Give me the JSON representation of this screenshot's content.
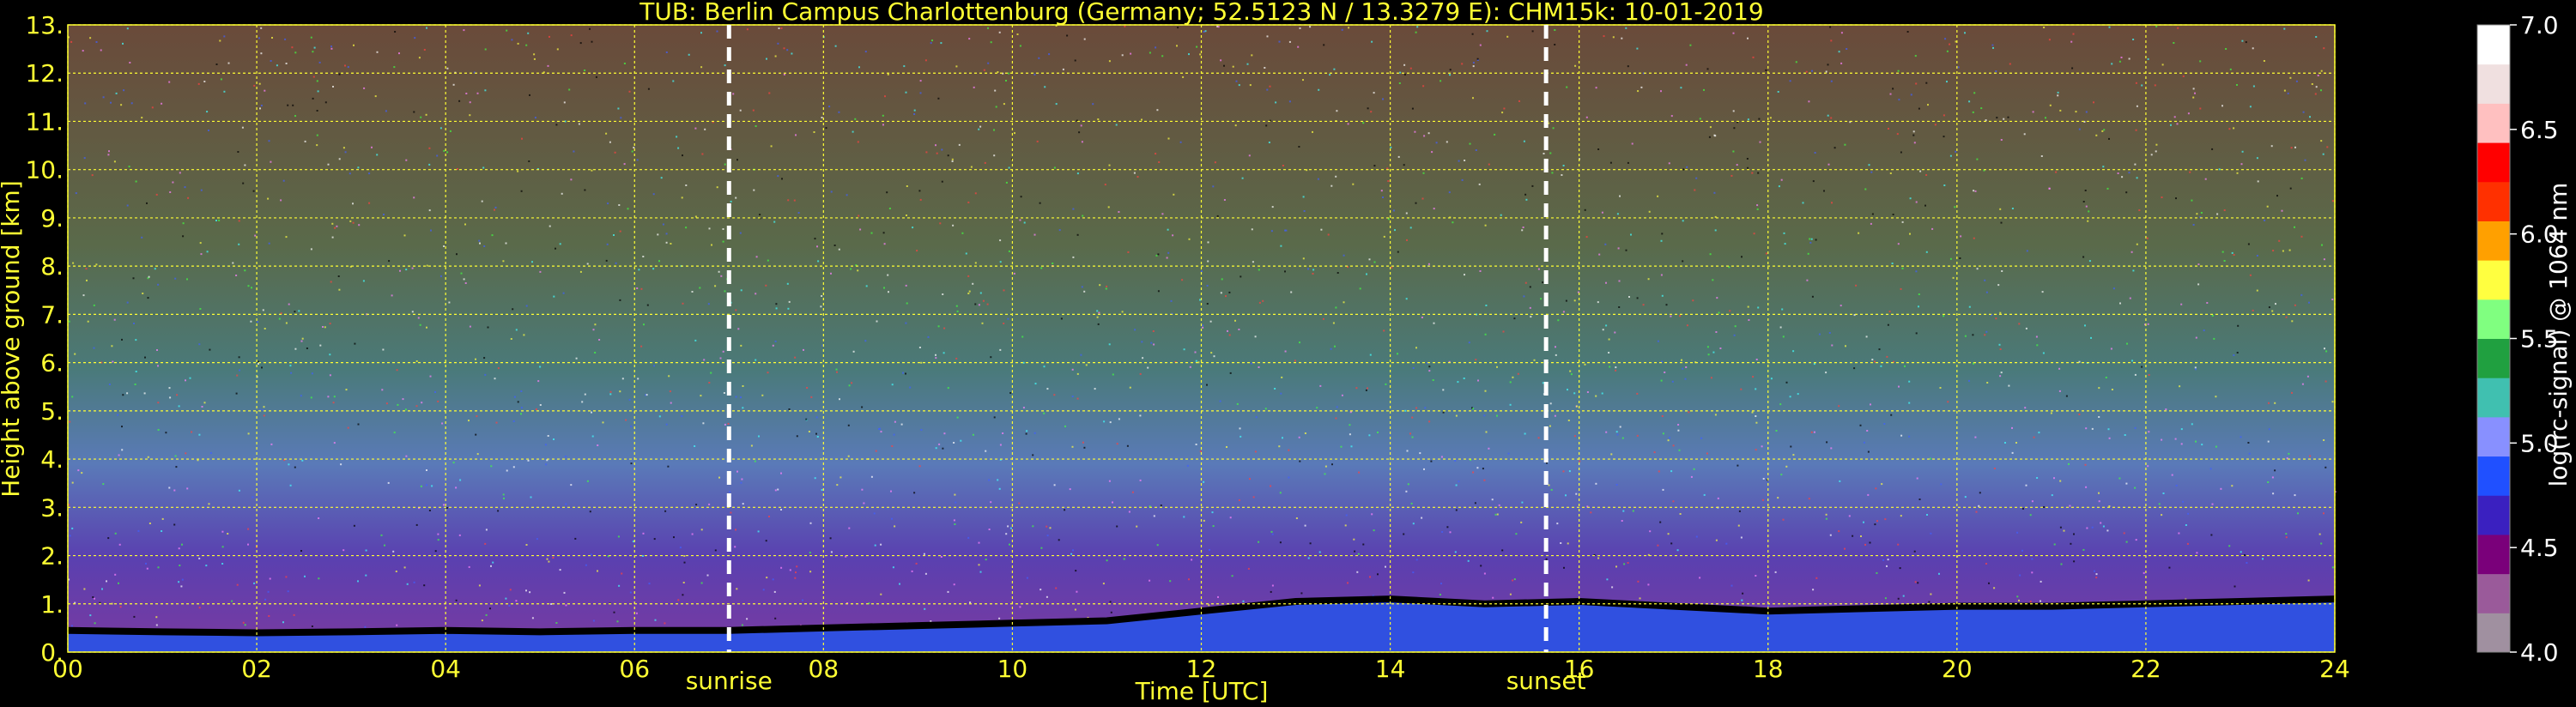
{
  "chart_data": {
    "type": "heatmap",
    "title": "TUB: Berlin Campus Charlottenburg (Germany; 52.5123 N / 13.3279 E):    CHM15k: 10-01-2019",
    "xlabel": "Time [UTC]",
    "ylabel": "Height above ground [km]",
    "xlim": [
      0,
      24
    ],
    "ylim": [
      0,
      13
    ],
    "x_ticks": [
      "00",
      "02",
      "04",
      "06",
      "08",
      "10",
      "12",
      "14",
      "16",
      "18",
      "20",
      "22",
      "24"
    ],
    "y_ticks": [
      "0.",
      "1.",
      "2.",
      "3.",
      "4.",
      "5.",
      "6.",
      "7.",
      "8.",
      "9.",
      "10.",
      "11.",
      "12.",
      "13."
    ],
    "grid": true,
    "colorbar": {
      "label": "log(rc-signal) @ 1064 nm",
      "range": [
        4.0,
        7.0
      ],
      "ticks": [
        "4.0",
        "4.5",
        "5.0",
        "5.5",
        "6.0",
        "6.5",
        "7.0"
      ]
    },
    "annotations": [
      {
        "label": "sunrise",
        "time": 7.0
      },
      {
        "label": "sunset",
        "time": 15.65
      }
    ],
    "boundary_layer_top_km": [
      {
        "t": 0,
        "h": 0.45
      },
      {
        "t": 1,
        "h": 0.42
      },
      {
        "t": 2,
        "h": 0.4
      },
      {
        "t": 3,
        "h": 0.42
      },
      {
        "t": 4,
        "h": 0.45
      },
      {
        "t": 5,
        "h": 0.42
      },
      {
        "t": 6,
        "h": 0.45
      },
      {
        "t": 7,
        "h": 0.45
      },
      {
        "t": 8,
        "h": 0.5
      },
      {
        "t": 9,
        "h": 0.55
      },
      {
        "t": 10,
        "h": 0.6
      },
      {
        "t": 11,
        "h": 0.65
      },
      {
        "t": 12,
        "h": 0.85
      },
      {
        "t": 13,
        "h": 1.05
      },
      {
        "t": 14,
        "h": 1.1
      },
      {
        "t": 15,
        "h": 1.0
      },
      {
        "t": 16,
        "h": 1.05
      },
      {
        "t": 17,
        "h": 0.95
      },
      {
        "t": 18,
        "h": 0.85
      },
      {
        "t": 19,
        "h": 0.9
      },
      {
        "t": 20,
        "h": 0.95
      },
      {
        "t": 21,
        "h": 0.95
      },
      {
        "t": 22,
        "h": 1.0
      },
      {
        "t": 23,
        "h": 1.05
      },
      {
        "t": 24,
        "h": 1.1
      }
    ],
    "colors": {
      "scale": [
        "#a090a0",
        "#9a5a9a",
        "#7a007a",
        "#3a20c0",
        "#2050ff",
        "#8890ff",
        "#40c0b0",
        "#20a040",
        "#80ff80",
        "#ffff40",
        "#ffa000",
        "#ff3000",
        "#ff0000",
        "#ffc0c0",
        "#f0e0e0",
        "#ffffff"
      ],
      "text": "#ffff33",
      "cbtext": "#ffffff",
      "grid": "#ffff33",
      "background": "#000000"
    }
  }
}
